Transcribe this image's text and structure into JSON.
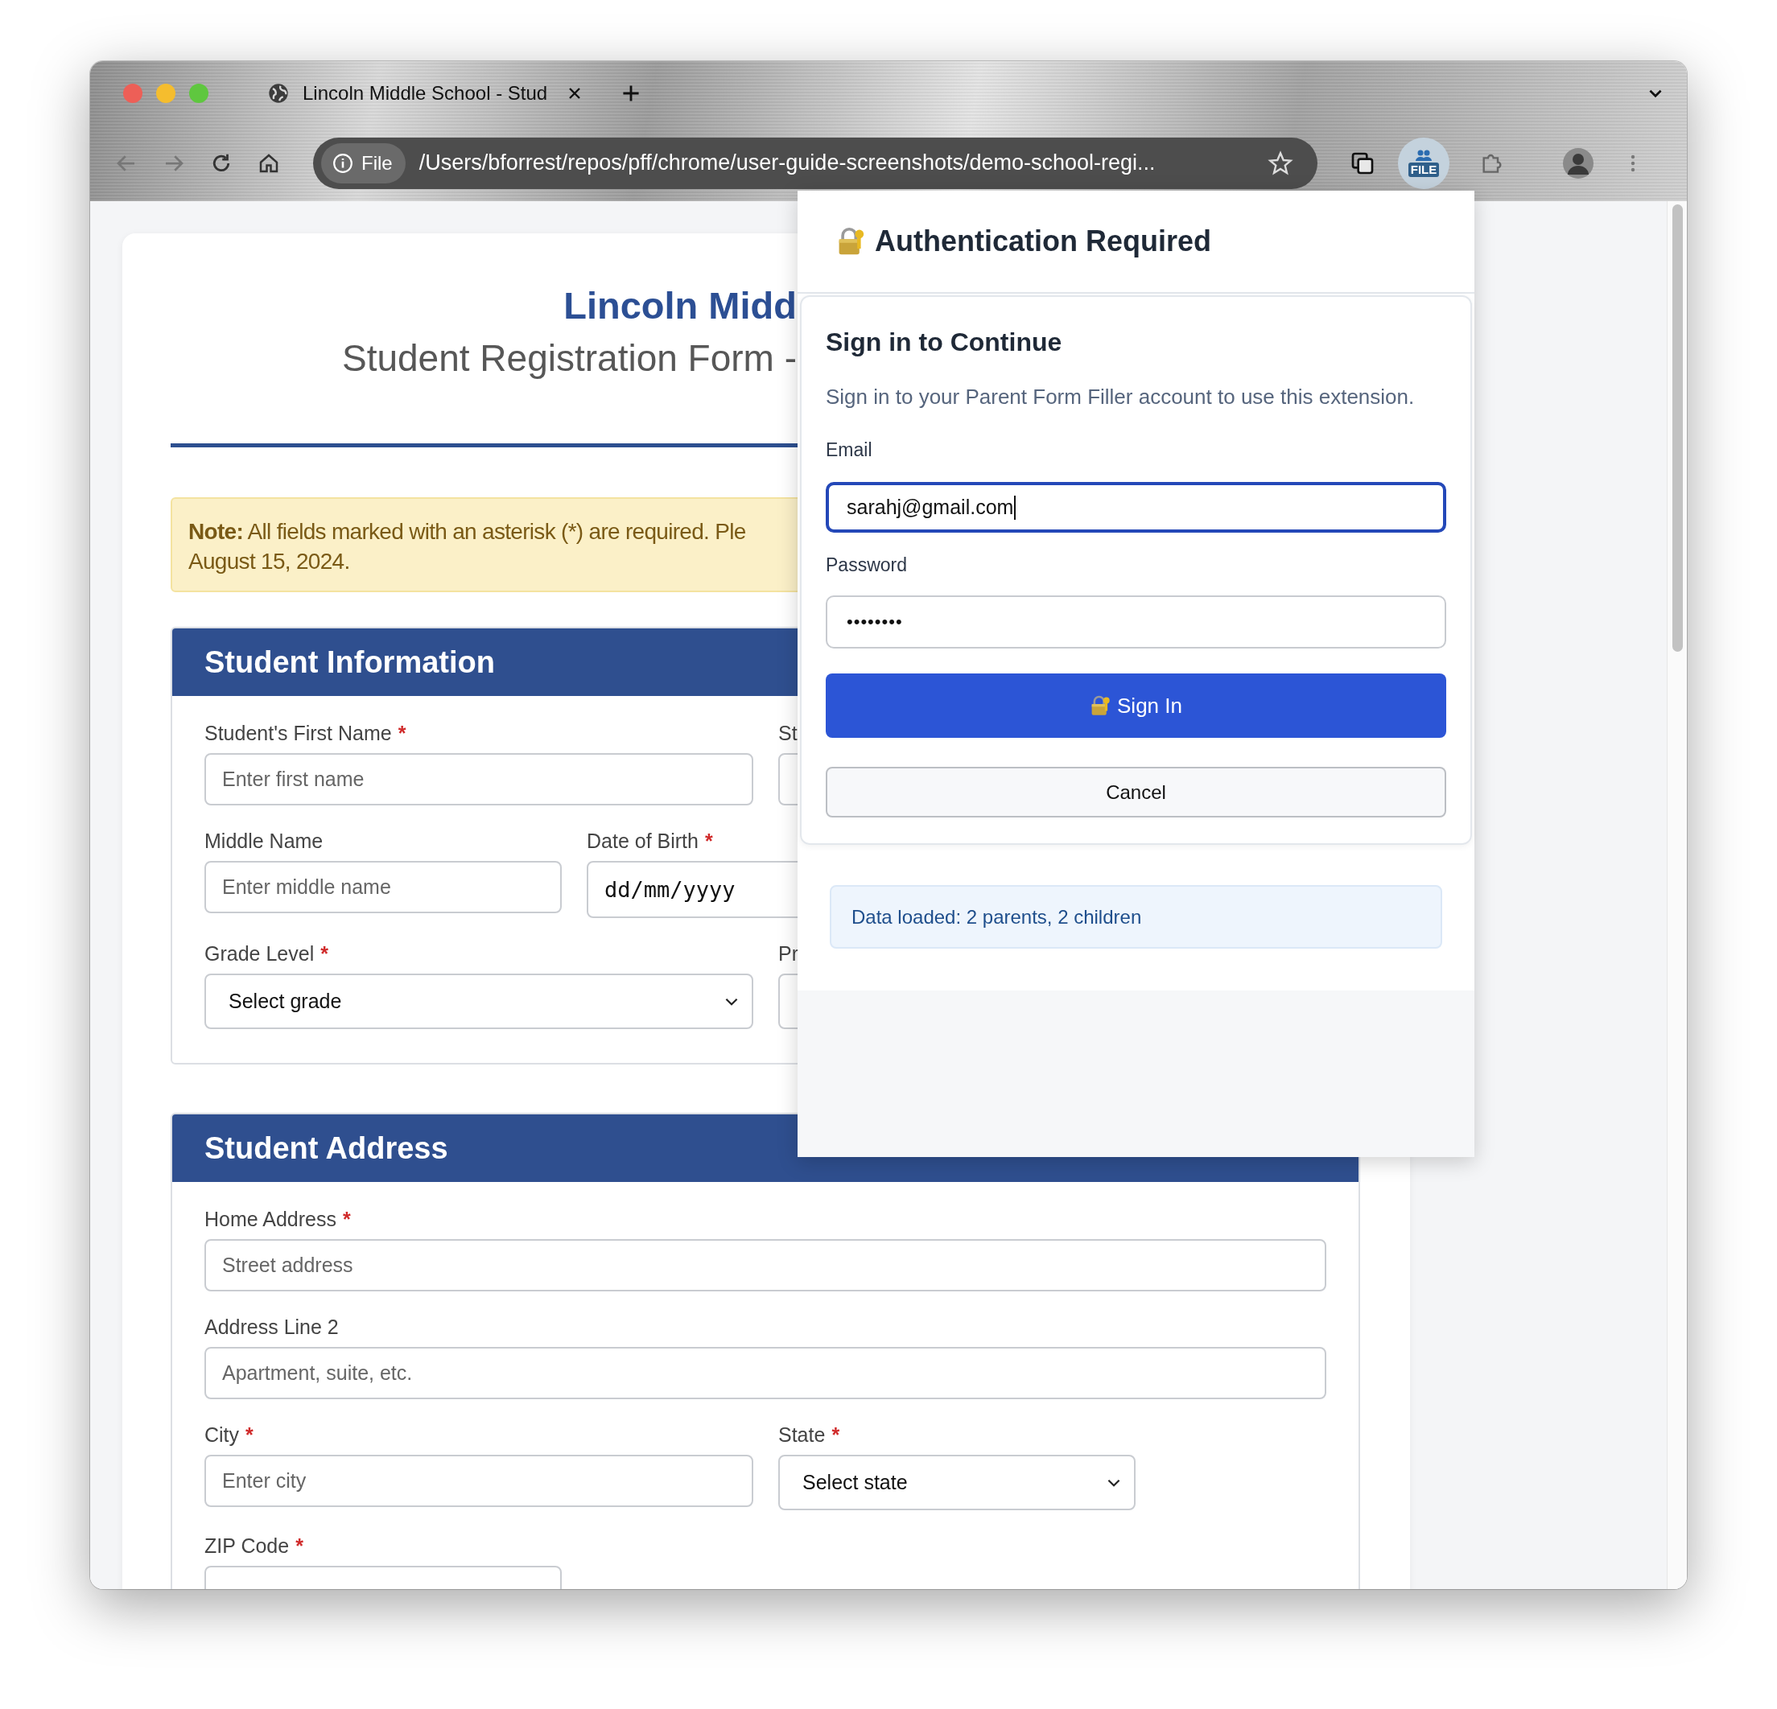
{
  "browser": {
    "tab": {
      "title": "Lincoln Middle School - Stud"
    },
    "address": {
      "chip": "File",
      "url": "/Users/bforrest/repos/pff/chrome/user-guide-screenshots/demo-school-regi..."
    },
    "extension_badge": "FILE"
  },
  "page": {
    "school_name": "Lincoln Midd",
    "subtitle": "Student Registration Form -",
    "note_lines": [
      "**Note:** All fields marked with an asterisk (*) are required. Ple",
      "August 15, 2024."
    ],
    "sections": [
      {
        "title": "Student Information",
        "rows": [
          {
            "kind": "halves",
            "fields": [
              {
                "kind": "input",
                "label": "Student's First Name",
                "mark": "*",
                "placeholder": "Enter first name"
              },
              {
                "kind": "input",
                "label": "St"
              }
            ]
          },
          {
            "kind": "thirds",
            "fields": [
              {
                "kind": "input",
                "label": "Middle Name",
                "placeholder": "Enter middle name"
              },
              {
                "kind": "date",
                "label": "Date of Birth",
                "mark": "*",
                "value": "dd/mm/yyyy"
              }
            ]
          },
          {
            "kind": "halves",
            "fields": [
              {
                "kind": "select",
                "label": "Grade Level",
                "mark": "*",
                "value": "Select grade"
              },
              {
                "kind": "select",
                "label": "Pr"
              }
            ]
          }
        ]
      },
      {
        "title": "Student Address",
        "rows": [
          {
            "kind": "full",
            "fields": [
              {
                "kind": "input",
                "label": "Home Address",
                "mark": "*",
                "placeholder": "Street address"
              }
            ]
          },
          {
            "kind": "full",
            "fields": [
              {
                "kind": "input",
                "label": "Address Line 2",
                "placeholder": "Apartment, suite, etc."
              }
            ]
          },
          {
            "kind": "half-third",
            "fields": [
              {
                "kind": "input",
                "label": "City",
                "mark": "*",
                "placeholder": "Enter city"
              },
              {
                "kind": "select",
                "label": "State",
                "mark": "*",
                "value": "Select state"
              }
            ]
          },
          {
            "kind": "thirds",
            "fields": [
              {
                "kind": "input",
                "label": "ZIP Code",
                "mark": "*"
              }
            ]
          }
        ]
      }
    ]
  },
  "popup": {
    "title": "Authentication Required",
    "heading": "Sign in to Continue",
    "description": "Sign in to your Parent Form Filler account to use this extension.",
    "fields": [
      {
        "kind": "email",
        "label": "Email",
        "value": "sarahj@gmail.com",
        "focused": true
      },
      {
        "kind": "password",
        "label": "Password",
        "value": "••••••••",
        "focused": false
      }
    ],
    "buttons": [
      {
        "kind": "primary",
        "label": "Sign In"
      },
      {
        "kind": "secondary",
        "label": "Cancel"
      }
    ],
    "info": "Data loaded: 2 parents, 2 children"
  }
}
